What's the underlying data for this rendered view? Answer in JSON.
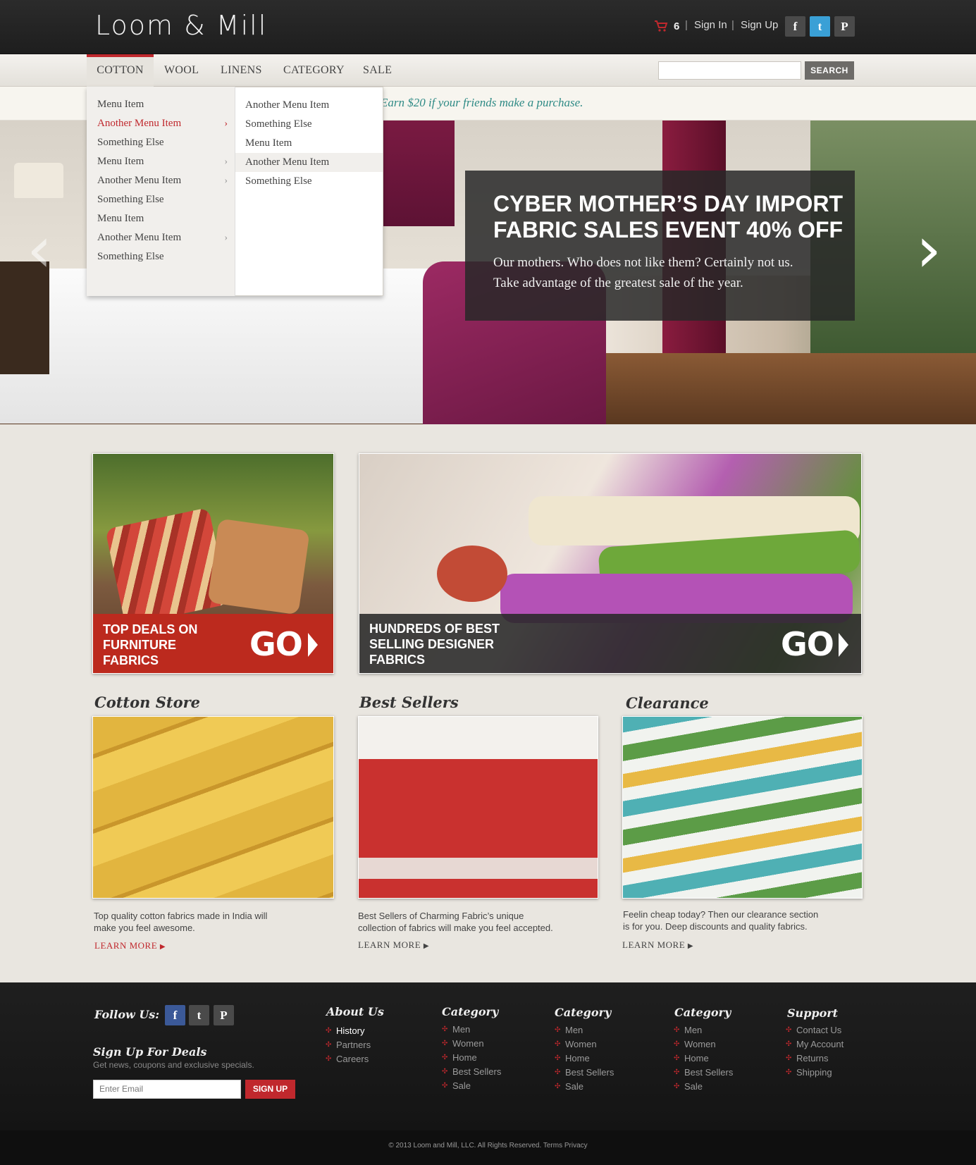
{
  "header": {
    "logo": "Loom & Mill",
    "cart_count": "6",
    "sep": "|",
    "sign_in": "Sign In",
    "sign_up": "Sign Up",
    "social": {
      "facebook": "f",
      "twitter": "t",
      "pinterest": "P"
    }
  },
  "nav": {
    "items": [
      "COTTON",
      "WOOL",
      "LINENS",
      "CATEGORY",
      "SALE"
    ],
    "search_button": "SEARCH"
  },
  "promo_text": "Earn $20 if your friends make a purchase.",
  "dropdown": {
    "col1": [
      {
        "label": "Menu Item",
        "arrow": false
      },
      {
        "label": "Another Menu Item",
        "arrow": true,
        "active": true
      },
      {
        "label": "Something Else",
        "arrow": false
      },
      {
        "label": "Menu Item",
        "arrow": true
      },
      {
        "label": "Another Menu Item",
        "arrow": true
      },
      {
        "label": "Something Else",
        "arrow": false
      },
      {
        "label": "Menu Item",
        "arrow": false
      },
      {
        "label": "Another Menu Item",
        "arrow": true
      },
      {
        "label": "Something Else",
        "arrow": false
      }
    ],
    "col2": [
      "Another Menu Item",
      "Something Else",
      "Menu Item",
      "Another Menu Item",
      "Something Else"
    ],
    "arrow_glyph": "›"
  },
  "hero": {
    "title_line1": "CYBER MOTHER’S DAY IMPORT",
    "title_line2": "FABRIC SALES EVENT 40% OFF",
    "body_line1": "Our mothers. Who does not like them? Certainly not us.",
    "body_line2": "Take advantage of the greatest sale of the year.",
    "prev": "‹",
    "next": "›"
  },
  "tiles": [
    {
      "line1": "TOP DEALS ON",
      "line2": "FURNITURE",
      "line3": "FABRICS",
      "go": "GO"
    },
    {
      "line1": "HUNDREDS OF BEST",
      "line2": "SELLING DESIGNER",
      "line3": "FABRICS",
      "go": "GO"
    }
  ],
  "cards": [
    {
      "title": "Cotton Store",
      "desc1": "Top quality cotton fabrics made in India will",
      "desc2": "make you feel awesome.",
      "learn": "LEARN MORE"
    },
    {
      "title": "Best Sellers",
      "desc1": "Best Sellers of Charming Fabric’s unique",
      "desc2": "collection of fabrics will make you feel accepted.",
      "learn": "LEARN MORE"
    },
    {
      "title": "Clearance",
      "desc1": "Feelin cheap today? Then our clearance section",
      "desc2": "is for you. Deep discounts and quality fabrics.",
      "learn": "LEARN MORE"
    }
  ],
  "footer": {
    "follow": "Follow Us:",
    "deals_title": "Sign Up For Deals",
    "deals_sub": "Get news, coupons and exclusive specials.",
    "email_placeholder": "Enter Email",
    "signup": "SIGN UP",
    "about": {
      "title": "About Us",
      "links": [
        "History",
        "Partners",
        "Careers"
      ]
    },
    "cat1": {
      "title": "Category",
      "links": [
        "Men",
        "Women",
        "Home",
        "Best Sellers",
        "Sale"
      ]
    },
    "cat2": {
      "title": "Category",
      "links": [
        "Men",
        "Women",
        "Home",
        "Best Sellers",
        "Sale"
      ]
    },
    "cat3": {
      "title": "Category",
      "links": [
        "Men",
        "Women",
        "Home",
        "Best Sellers",
        "Sale"
      ]
    },
    "support": {
      "title": "Support",
      "links": [
        "Contact Us",
        "My Account",
        "Returns",
        "Shipping"
      ]
    },
    "copyright": "© 2013 Loom and Mill, LLC.  All Rights Reserved.  Terms  Privacy"
  },
  "colors": {
    "accent": "#c0282d",
    "promo": "#2e8a85",
    "facebook": "#3b5998",
    "twitter": "#3aa0d6"
  }
}
